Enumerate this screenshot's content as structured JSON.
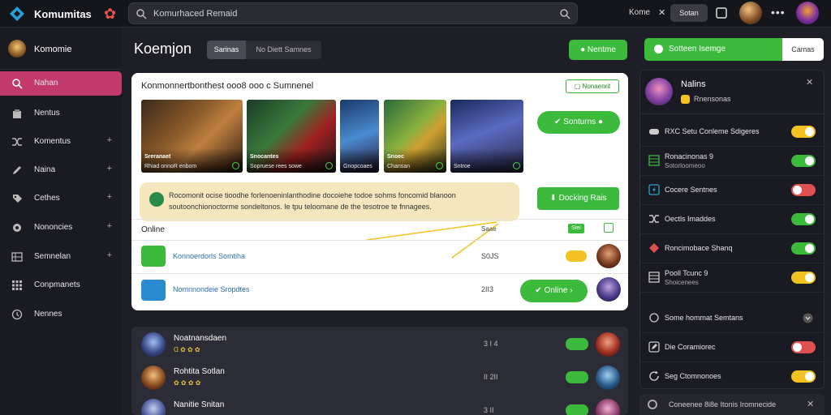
{
  "topbar": {
    "app_title": "Komumitas",
    "search_placeholder": "Komurhaced Remaid",
    "link_label": "Kome",
    "close_label": "✕",
    "button_label": "Sotan",
    "avatar_alt": "User avatar"
  },
  "sidebar": {
    "profile_name": "Komomie",
    "items": [
      {
        "label": "Nahan",
        "icon": "search-circle-icon",
        "active": true
      },
      {
        "label": "Nentus",
        "icon": "store-icon"
      },
      {
        "label": "Komentus",
        "icon": "shuffle-icon",
        "plus": "+"
      },
      {
        "label": "Naina",
        "icon": "pencil-icon",
        "plus": "+"
      },
      {
        "label": "Cethes",
        "icon": "tag-icon",
        "plus": "+"
      },
      {
        "label": "Nononcies",
        "icon": "record-icon",
        "plus": "+"
      },
      {
        "label": "Semnelan",
        "icon": "grid-list-icon",
        "plus": "+"
      },
      {
        "label": "Conpmanets",
        "icon": "apps-icon"
      },
      {
        "label": "Nennes",
        "icon": "clock-icon"
      }
    ]
  },
  "main": {
    "title": "Koemjon",
    "tab_a": "Sarinas",
    "tab_b": "No Diett Samnes",
    "green_button": "Nentme",
    "card": {
      "title": "Konmonnertbonthest ooo8 ooo c Sumnenel",
      "tag": "Nonaenrit",
      "thumbs": [
        {
          "caption": "Sreranaet",
          "sub": "Rhiad onnoR enbom"
        },
        {
          "caption": "Snocantes",
          "sub": "Sopruese rees sowe"
        },
        {
          "caption": "",
          "sub": "Gnopcoaes"
        },
        {
          "caption": "Snoec",
          "sub": "Chansan"
        },
        {
          "caption": "",
          "sub": "Sntroe"
        }
      ],
      "btn_top": "Sonturns",
      "btn_mid": "Docking Rais",
      "tooltip_text": "Rocomonit ocise tioodhe forlenoeninlanthodine docoiehe todoe sohms foncomid blanoon soutoonchionoctorme sondeltonos. Ie tpu teloomane de the tesotroe te fnnagees.",
      "online_label": "Online",
      "col_header": "Saae",
      "col_badge": "Siei",
      "rows": [
        {
          "name": "Konnoerdorls Somtiha",
          "value": "S0JS"
        },
        {
          "name": "Nomnnondeie Sropdtes",
          "value": "2ΙΙ3"
        }
      ],
      "online_btn": "Online"
    },
    "panel2": [
      {
        "name": "Noatnansdaen",
        "meta": "Ɑ ✿ ✿ ✿",
        "value": "3 Ι 4"
      },
      {
        "name": "Rohtita Sotlan",
        "meta": "✿ ✿ ✿ ✿",
        "value": "ΙΙ 2ΙΙ"
      },
      {
        "name": "Nanitie Snitan",
        "meta": "",
        "value": "3 ΙΙ"
      }
    ]
  },
  "right": {
    "head_label": "Sotteen Isemge",
    "head_btn": "Camas",
    "user_name": "Nalins",
    "user_sub": "Rnensonas",
    "rows": [
      {
        "label": "RXC Setu Conleme Sdigeres",
        "toggle": "yellow",
        "on": true
      },
      {
        "label": "Ronacinonas 9",
        "sub": "Sotorloomeoo",
        "toggle": "green",
        "on": true
      },
      {
        "label": "Cocere Sentnes",
        "toggle": "red",
        "on": false
      },
      {
        "label": "Oectls Imaddes",
        "toggle": "green",
        "on": true
      },
      {
        "label": "Roncimobace Shanq",
        "toggle": "green",
        "on": true
      },
      {
        "label": "Pooll Tcunc 9",
        "sub": "Shoicenees",
        "toggle": "yellow",
        "on": true
      },
      {
        "label": "Some hommat Semtans",
        "toggle": "none"
      },
      {
        "label": "Die Coramiorec",
        "toggle": "red",
        "on": false
      },
      {
        "label": "Seg Ctomnonoes",
        "toggle": "yellow",
        "on": true
      }
    ],
    "footer_label": "Coneenee 8i8e Itonis Iromnecide"
  },
  "colors": {
    "accent_green": "#3cba3c",
    "accent_pink": "#c13a6a",
    "accent_yellow": "#f2c320",
    "accent_red": "#e05050"
  }
}
